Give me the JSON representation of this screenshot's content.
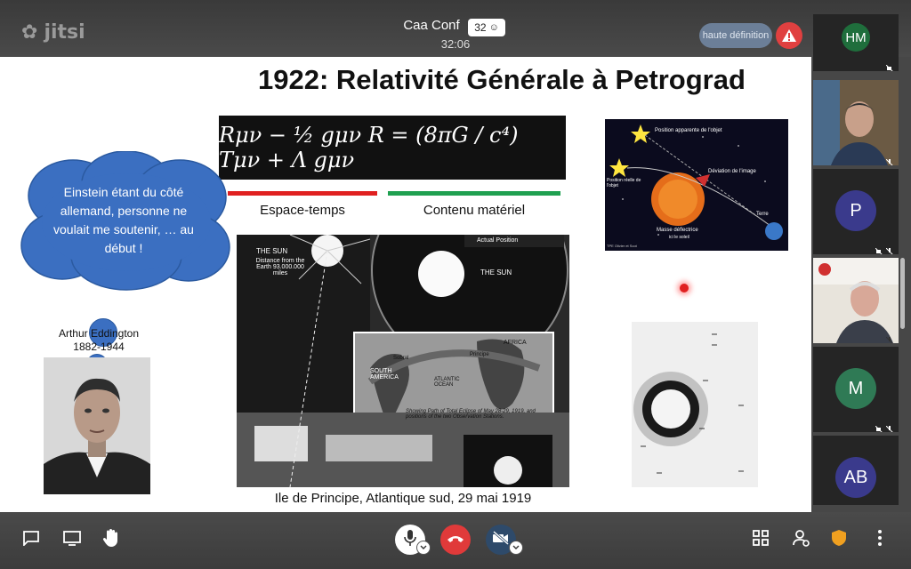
{
  "header": {
    "logo_text": "jitsi",
    "conference_name": "Caa Conf",
    "participant_count": "32",
    "timer": "32:06",
    "quality_label": "haute définition"
  },
  "slide": {
    "title": "1922: Relativité Générale à Petrograd",
    "formula": "Rμν − ½ gμν R = (8πG / c⁴) Tμν + Λ gμν",
    "label_left": "Espace-temps",
    "label_right": "Contenu matériel",
    "caption": "Ile de Principe, Atlantique sud, 29 mai 1919",
    "bubble_text": "Einstein étant du côté allemand, personne ne voulait me soutenir, … au début !",
    "person_name": "Arthur Eddington",
    "person_dates": "1882-1944",
    "figure_labels": {
      "sun": "THE SUN",
      "distance": "Distance from the Earth 93.000.000 miles",
      "sun_right": "THE SUN",
      "actual_position": "Actual Position",
      "africa": "AFRICA",
      "south_america": "SOUTH AMERICA",
      "atlantic": "ATLANTIC OCEAN",
      "principe": "Principe",
      "sobral": "Sobral",
      "path_caption": "Showing Path of Total Eclipse of May 28-29, 1919, and positions of the two Observation Stations."
    },
    "deflection_labels": {
      "apparent": "Position apparente de l'objet",
      "deviation": "Déviation de l'image",
      "real": "Position réelle de l'objet",
      "mass": "Masse déflectrice",
      "mass_sub": "ici le soleil",
      "earth": "Terre",
      "credit": "TPE Olivier et Scot"
    }
  },
  "participants": [
    {
      "initials": "HM",
      "color": "#1f6e3c",
      "video": false
    },
    {
      "initials": "",
      "color": "",
      "video": true
    },
    {
      "initials": "P",
      "color": "#3a3a8c",
      "video": false
    },
    {
      "initials": "",
      "color": "",
      "video": true
    },
    {
      "initials": "M",
      "color": "#2f7a55",
      "video": false
    },
    {
      "initials": "AB",
      "color": "#3a3a8c",
      "video": false
    }
  ],
  "colors": {
    "warning": "#e04040",
    "bubble": "#3b6fc1",
    "red_underline": "#e02020",
    "green_underline": "#1fa050",
    "hangup": "#e03a3a",
    "shield": "#f0a020"
  },
  "toolbar": {
    "left": [
      "chat-icon",
      "screen-share-icon",
      "raise-hand-icon"
    ],
    "center": [
      "microphone-icon",
      "hangup-icon",
      "camera-off-icon"
    ],
    "right": [
      "tile-view-icon",
      "participants-icon",
      "security-shield-icon",
      "more-options-icon"
    ]
  }
}
